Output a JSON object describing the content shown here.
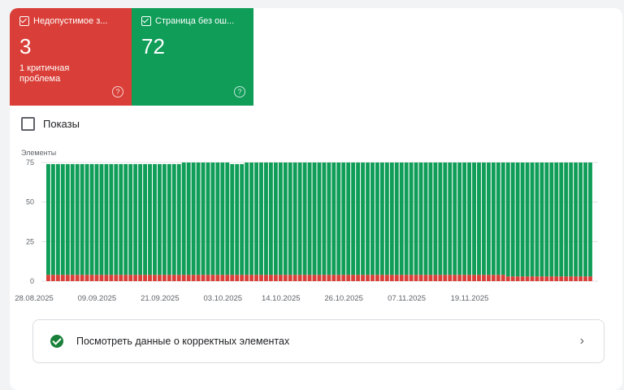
{
  "tiles": {
    "invalid": {
      "title": "Недопустимое з...",
      "value": "3",
      "subtitle": "1 критичная проблема",
      "color": "#d93f38"
    },
    "valid": {
      "title": "Страница без ош...",
      "value": "72",
      "color": "#0f9d58"
    }
  },
  "impressions_label": "Показы",
  "bottom_link": {
    "label": "Посмотреть данные о корректных элементах"
  },
  "chart_data": {
    "type": "bar",
    "stacked": true,
    "ylabel": "Элементы",
    "ylim": [
      0,
      75
    ],
    "yticks": [
      0,
      25,
      50,
      75
    ],
    "xticks": [
      "28.08.2025",
      "09.09.2025",
      "21.09.2025",
      "03.10.2025",
      "14.10.2025",
      "26.10.2025",
      "07.11.2025",
      "19.11.2025"
    ],
    "series": [
      {
        "name": "Недопустимое",
        "color": "#d93f38",
        "values": [
          4,
          4,
          4,
          4,
          4,
          4,
          4,
          4,
          4,
          4,
          4,
          4,
          4,
          4,
          4,
          4,
          4,
          4,
          4,
          4,
          4,
          4,
          4,
          4,
          4,
          4,
          4,
          4,
          4,
          4,
          4,
          4,
          4,
          4,
          4,
          4,
          4,
          4,
          4,
          4,
          4,
          4,
          4,
          4,
          4,
          4,
          4,
          4,
          4,
          4,
          4,
          4,
          4,
          4,
          4,
          4,
          4,
          4,
          4,
          4,
          4,
          4,
          4,
          4,
          4,
          4,
          4,
          4,
          4,
          4,
          4,
          4,
          4,
          4,
          4,
          4,
          4,
          4,
          4,
          4,
          4,
          4,
          4,
          4,
          4,
          4,
          4,
          4,
          4,
          4,
          4,
          4,
          4,
          4,
          4,
          3,
          3,
          3,
          3,
          3,
          3,
          3,
          3,
          3,
          3,
          3,
          3,
          3,
          3,
          3,
          3,
          3,
          3
        ]
      },
      {
        "name": "Страница без ошибок",
        "color": "#0f9d58",
        "values": [
          70,
          70,
          70,
          70,
          70,
          70,
          70,
          70,
          70,
          70,
          70,
          70,
          70,
          70,
          70,
          70,
          70,
          70,
          70,
          70,
          70,
          70,
          70,
          70,
          70,
          70,
          70,
          70,
          71,
          71,
          71,
          71,
          71,
          71,
          71,
          71,
          71,
          71,
          70,
          70,
          70,
          71,
          71,
          71,
          71,
          71,
          71,
          71,
          71,
          71,
          71,
          71,
          71,
          71,
          71,
          71,
          71,
          71,
          71,
          71,
          71,
          71,
          71,
          71,
          71,
          71,
          71,
          71,
          71,
          71,
          71,
          71,
          71,
          71,
          71,
          71,
          71,
          71,
          71,
          71,
          71,
          71,
          71,
          71,
          71,
          71,
          71,
          71,
          71,
          71,
          71,
          71,
          71,
          71,
          71,
          72,
          72,
          72,
          72,
          72,
          72,
          72,
          72,
          72,
          72,
          72,
          72,
          72,
          72,
          72,
          72,
          72,
          72
        ]
      }
    ]
  }
}
